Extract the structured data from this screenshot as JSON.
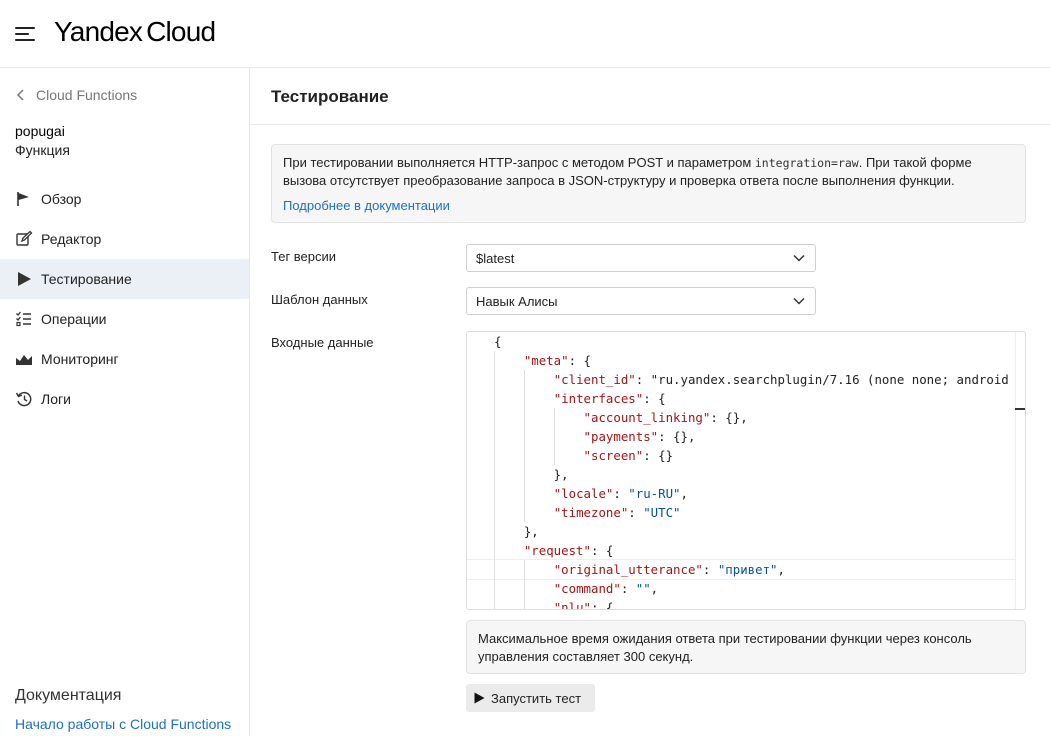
{
  "header": {
    "logo_main": "Yandex",
    "logo_sub": "Cloud"
  },
  "sidebar": {
    "back_label": "Cloud Functions",
    "function_name": "popugai",
    "function_type": "Функция",
    "items": [
      {
        "label": "Обзор",
        "icon": "flag-icon"
      },
      {
        "label": "Редактор",
        "icon": "edit-icon"
      },
      {
        "label": "Тестирование",
        "icon": "play-icon",
        "active": true
      },
      {
        "label": "Операции",
        "icon": "list-icon"
      },
      {
        "label": "Мониторинг",
        "icon": "chart-icon"
      },
      {
        "label": "Логи",
        "icon": "history-icon"
      }
    ],
    "docs_title": "Документация",
    "docs_link": "Начало работы с Cloud Functions"
  },
  "main": {
    "title": "Тестирование",
    "info": {
      "text_before": "При тестировании выполняется HTTP-запрос с методом POST и параметром ",
      "code": "integration=raw",
      "text_after": ". При такой форме вызова отсутствует преобразование запроса в JSON-структуру и проверка ответа после выполнения функции.",
      "link": "Подробнее в документации"
    },
    "form": {
      "version_tag_label": "Тег версии",
      "version_tag_value": "$latest",
      "template_label": "Шаблон данных",
      "template_value": "Навык Алисы",
      "input_label": "Входные данные"
    },
    "code_lines": [
      "{",
      "    \"meta\": {",
      "        \"client_id\": \"ru.yandex.searchplugin/7.16 (none none; android",
      "        \"interfaces\": {",
      "            \"account_linking\": {},",
      "            \"payments\": {},",
      "            \"screen\": {}",
      "        },",
      "        \"locale\": \"ru-RU\",",
      "        \"timezone\": \"UTC\"",
      "    },",
      "    \"request\": {",
      "        \"original_utterance\": \"привет\",",
      "        \"command\": \"\",",
      "        \"nlu\": {"
    ],
    "note": "Максимальное время ожидания ответа при тестировании функции через консоль управления составляет 300 секунд.",
    "run_button": "Запустить тест"
  },
  "colors": {
    "accent_link": "#1f6fc5",
    "active_nav_bg": "#ebf0f7",
    "json_key": "#a31515",
    "json_string": "#0451a5"
  }
}
